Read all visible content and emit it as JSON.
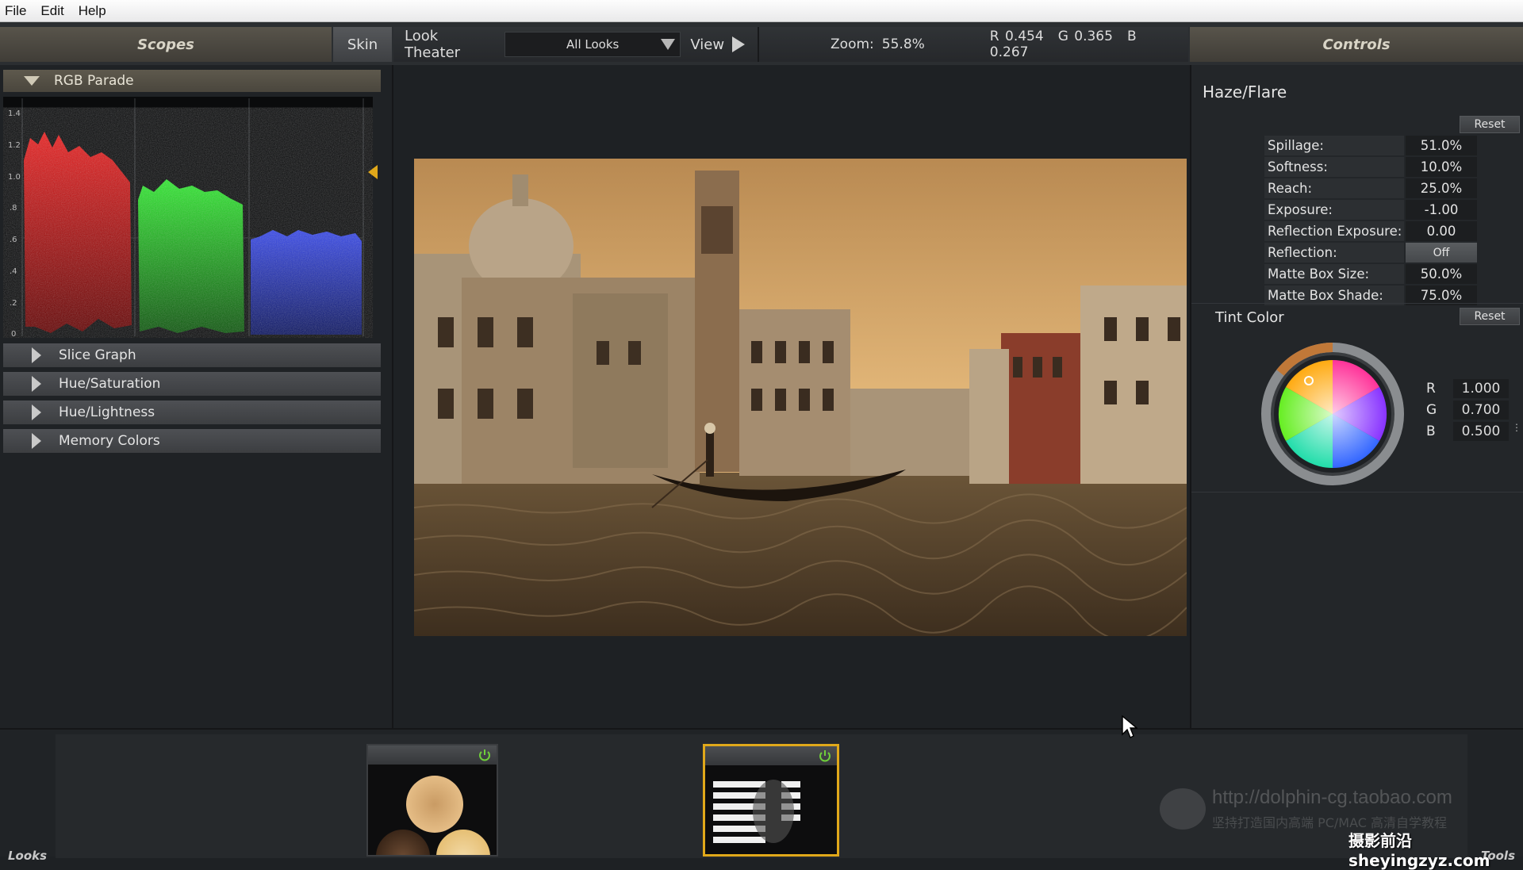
{
  "menu": [
    "File",
    "Edit",
    "Help"
  ],
  "header": {
    "scopes_tab": "Scopes",
    "skin_button": "Skin",
    "look_theater": "Look Theater",
    "looks_dropdown": "All Looks",
    "view_label": "View",
    "zoom_label": "Zoom:",
    "zoom_value": "55.8%",
    "readout_r": "R 0.454",
    "readout_g": "G 0.365",
    "readout_b": "B 0.267",
    "controls_tab": "Controls"
  },
  "scopes": {
    "open_section": "RGB Parade",
    "axis_ticks": [
      "1.4",
      "1.2",
      "1.0",
      ".8",
      ".6",
      ".4",
      ".2",
      "0"
    ],
    "sections": [
      "Slice Graph",
      "Hue/Saturation",
      "Hue/Lightness",
      "Memory Colors"
    ]
  },
  "controls": {
    "section_title": "Haze/Flare",
    "reset_label": "Reset",
    "params": [
      {
        "label": "Spillage:",
        "value": "51.0%"
      },
      {
        "label": "Softness:",
        "value": "10.0%"
      },
      {
        "label": "Reach:",
        "value": "25.0%"
      },
      {
        "label": "Exposure:",
        "value": "-1.00"
      },
      {
        "label": "Reflection Exposure:",
        "value": "0.00"
      },
      {
        "label": "Reflection:",
        "value": "Off"
      },
      {
        "label": "Matte Box Size:",
        "value": "50.0%"
      },
      {
        "label": "Matte Box Shade:",
        "value": "75.0%"
      }
    ],
    "tint": {
      "title": "Tint Color",
      "reset_label": "Reset",
      "r_label": "R",
      "r_value": "1.000",
      "g_label": "G",
      "g_value": "0.700",
      "b_label": "B",
      "b_value": "0.500"
    }
  },
  "bottom": {
    "looks_tab": "Looks",
    "tools_tab": "Tools"
  },
  "watermark": {
    "url": "http://dolphin-cg.taobao.com",
    "subtitle": "坚持打造国内高端 PC/MAC 高清自学教程",
    "site": "摄影前沿 sheyingzyz.com"
  },
  "colors": {
    "accent_gold": "#e0a81a",
    "power_green": "#6fcf3a",
    "panel_tan": "#58544b"
  }
}
